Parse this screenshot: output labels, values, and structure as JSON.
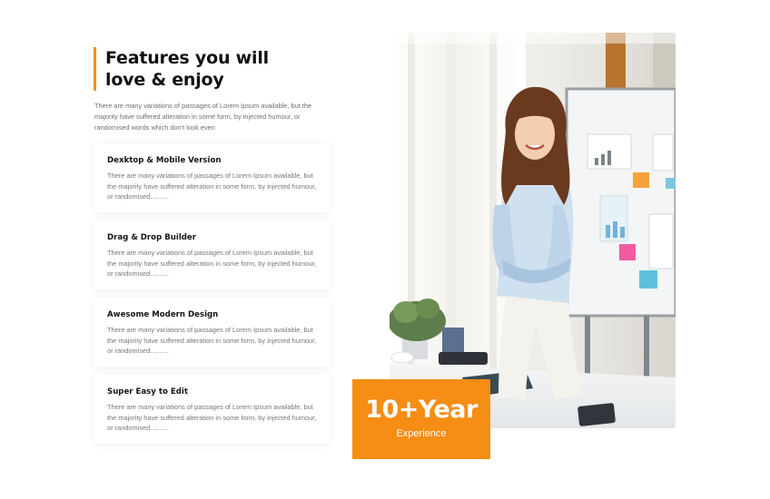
{
  "section": {
    "heading_line1": "Features you will",
    "heading_line2": "love & enjoy",
    "intro": "There are many variations of passages of Lorem Ipsum available, but the majority have suffered alteration in some form, by injected humour, or randomised words which don't look even"
  },
  "features": [
    {
      "title": "Dexktop & Mobile Version",
      "text": "There are many variations of passages of Lorem Ipsum available, but the majority have suffered alteration in some form, by injected humour, or randomised.........."
    },
    {
      "title": "Drag & Drop Builder",
      "text": "There are many variations of passages of Lorem Ipsum available, but the majority have suffered alteration in some form, by injected humour, or randomised.........."
    },
    {
      "title": "Awesome Modern Design",
      "text": "There are many variations of passages of Lorem Ipsum available, but the majority have suffered alteration in some form, by injected humour, or randomised.........."
    },
    {
      "title": "Super Easy to Edit",
      "text": "There are many variations of passages of Lorem Ipsum available, but the majority have suffered alteration in some form, by injected humour, or randomised.........."
    }
  ],
  "badge": {
    "number": "10+Year",
    "label": "Experience"
  },
  "colors": {
    "accent": "#f68d14",
    "heading": "#111111",
    "body_text": "#777777"
  }
}
